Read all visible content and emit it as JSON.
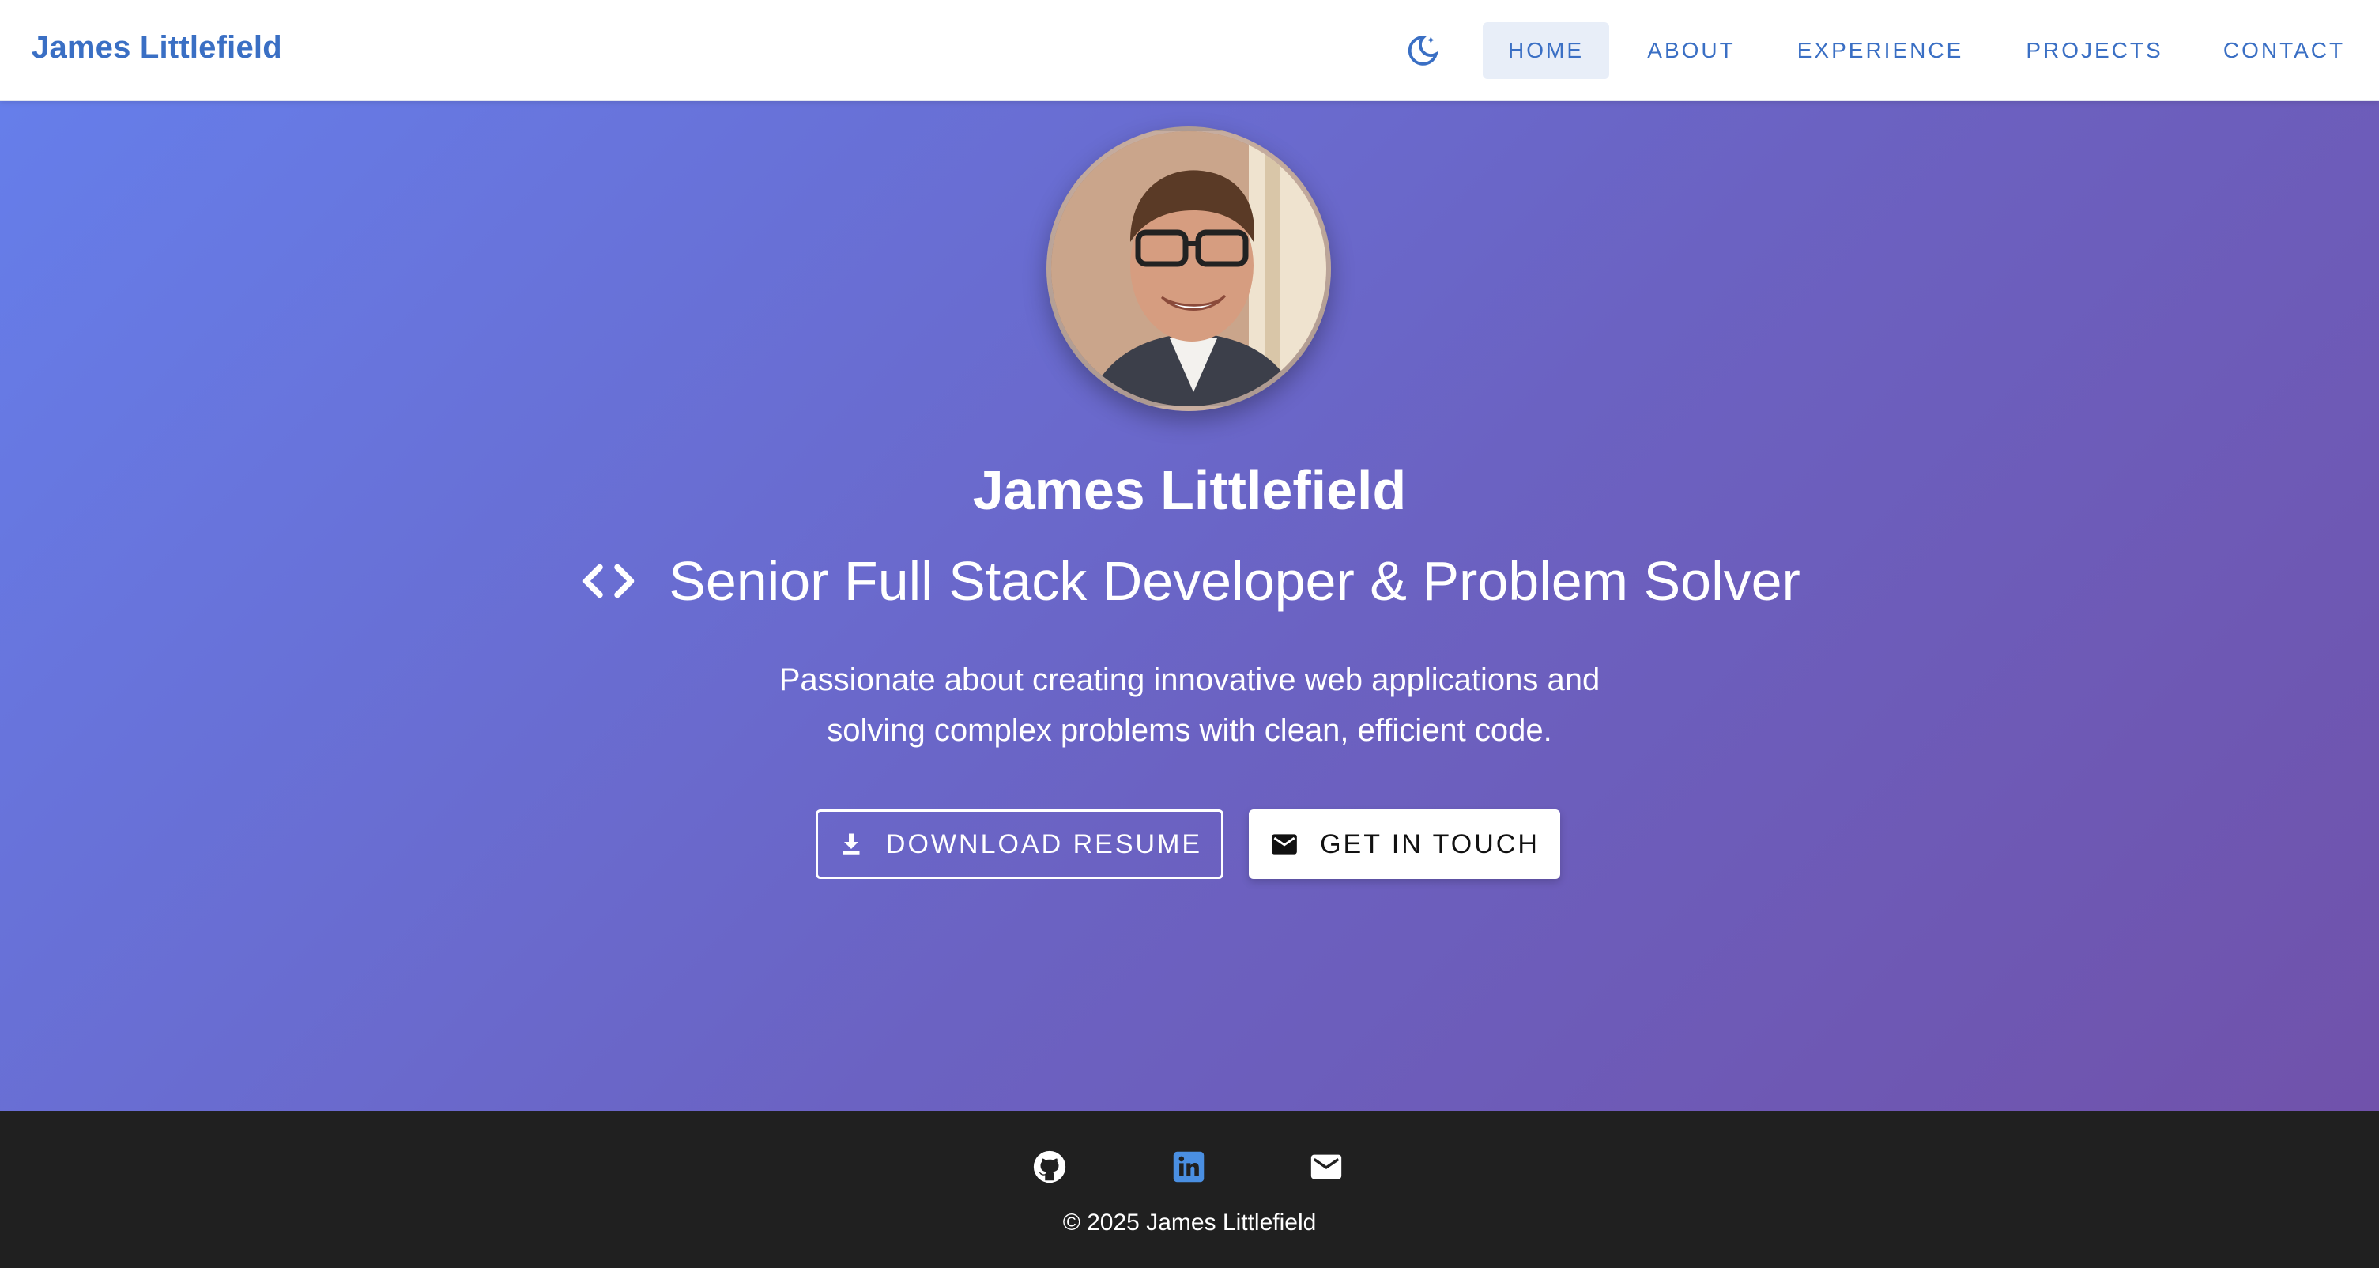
{
  "brand": {
    "name": "James Littlefield",
    "color": "#3a6fc4"
  },
  "header": {
    "theme_toggle_icon": "moon-star-icon",
    "nav": [
      {
        "label": "HOME",
        "active": true
      },
      {
        "label": "ABOUT",
        "active": false
      },
      {
        "label": "EXPERIENCE",
        "active": false
      },
      {
        "label": "PROJECTS",
        "active": false
      },
      {
        "label": "CONTACT",
        "active": false
      }
    ]
  },
  "hero": {
    "avatar_alt": "profile-photo",
    "name": "James Littlefield",
    "title_icon": "code-icon",
    "title": "Senior Full Stack Developer & Problem Solver",
    "description_line1": "Passionate about creating innovative web applications and",
    "description_line2": "solving complex problems with clean, efficient code.",
    "buttons": {
      "resume": {
        "label": "DOWNLOAD RESUME",
        "icon": "download-icon"
      },
      "contact": {
        "label": "GET IN TOUCH",
        "icon": "mail-icon"
      }
    },
    "gradient": [
      "#667eea",
      "#7052ab"
    ]
  },
  "footer": {
    "icons": [
      "github-icon",
      "linkedin-icon",
      "mail-icon"
    ],
    "linkedin_color": "#4a8fe2",
    "copyright": "© 2025 James Littlefield"
  }
}
